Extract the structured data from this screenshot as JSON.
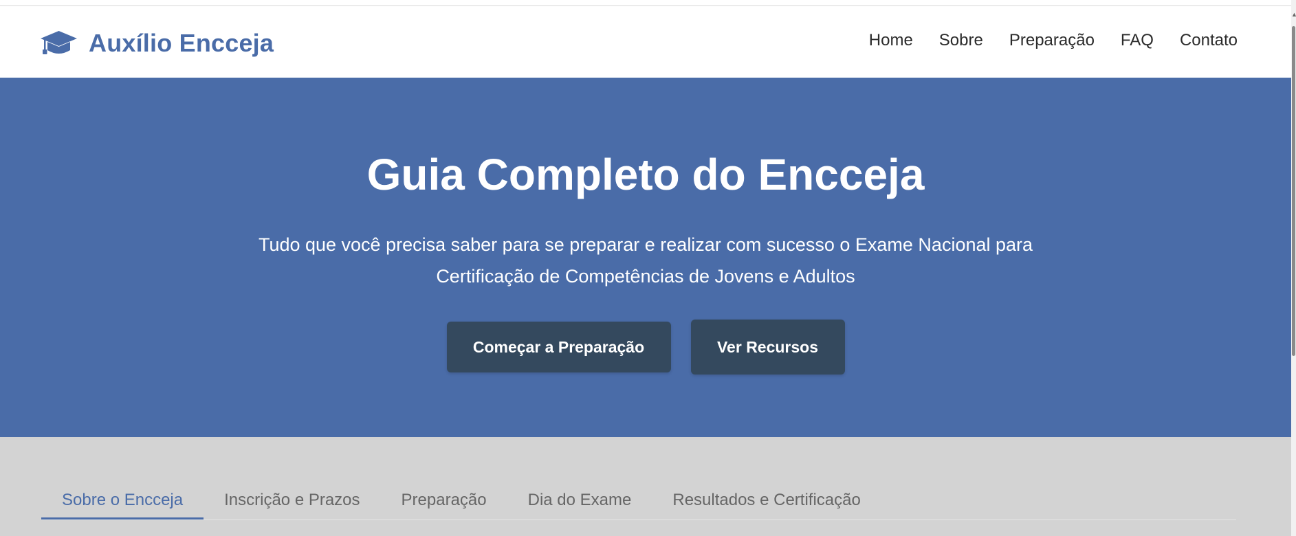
{
  "header": {
    "brand": "Auxílio Encceja",
    "brand_icon": "graduation-cap-icon",
    "brand_color": "#4a6ca8",
    "nav": [
      {
        "label": "Home"
      },
      {
        "label": "Sobre"
      },
      {
        "label": "Preparação"
      },
      {
        "label": "FAQ"
      },
      {
        "label": "Contato"
      }
    ]
  },
  "hero": {
    "title": "Guia Completo do Encceja",
    "subtitle": "Tudo que você precisa saber para se preparar e realizar com sucesso o Exame Nacional para Certificação de Competências de Jovens e Adultos",
    "primary_button": "Começar a Preparação",
    "secondary_button": "Ver Recursos",
    "background_color": "#4a6ca8",
    "button_color": "#34495e"
  },
  "tabs": {
    "items": [
      {
        "label": "Sobre o Encceja",
        "active": true
      },
      {
        "label": "Inscrição e Prazos",
        "active": false
      },
      {
        "label": "Preparação",
        "active": false
      },
      {
        "label": "Dia do Exame",
        "active": false
      },
      {
        "label": "Resultados e Certificação",
        "active": false
      }
    ]
  }
}
